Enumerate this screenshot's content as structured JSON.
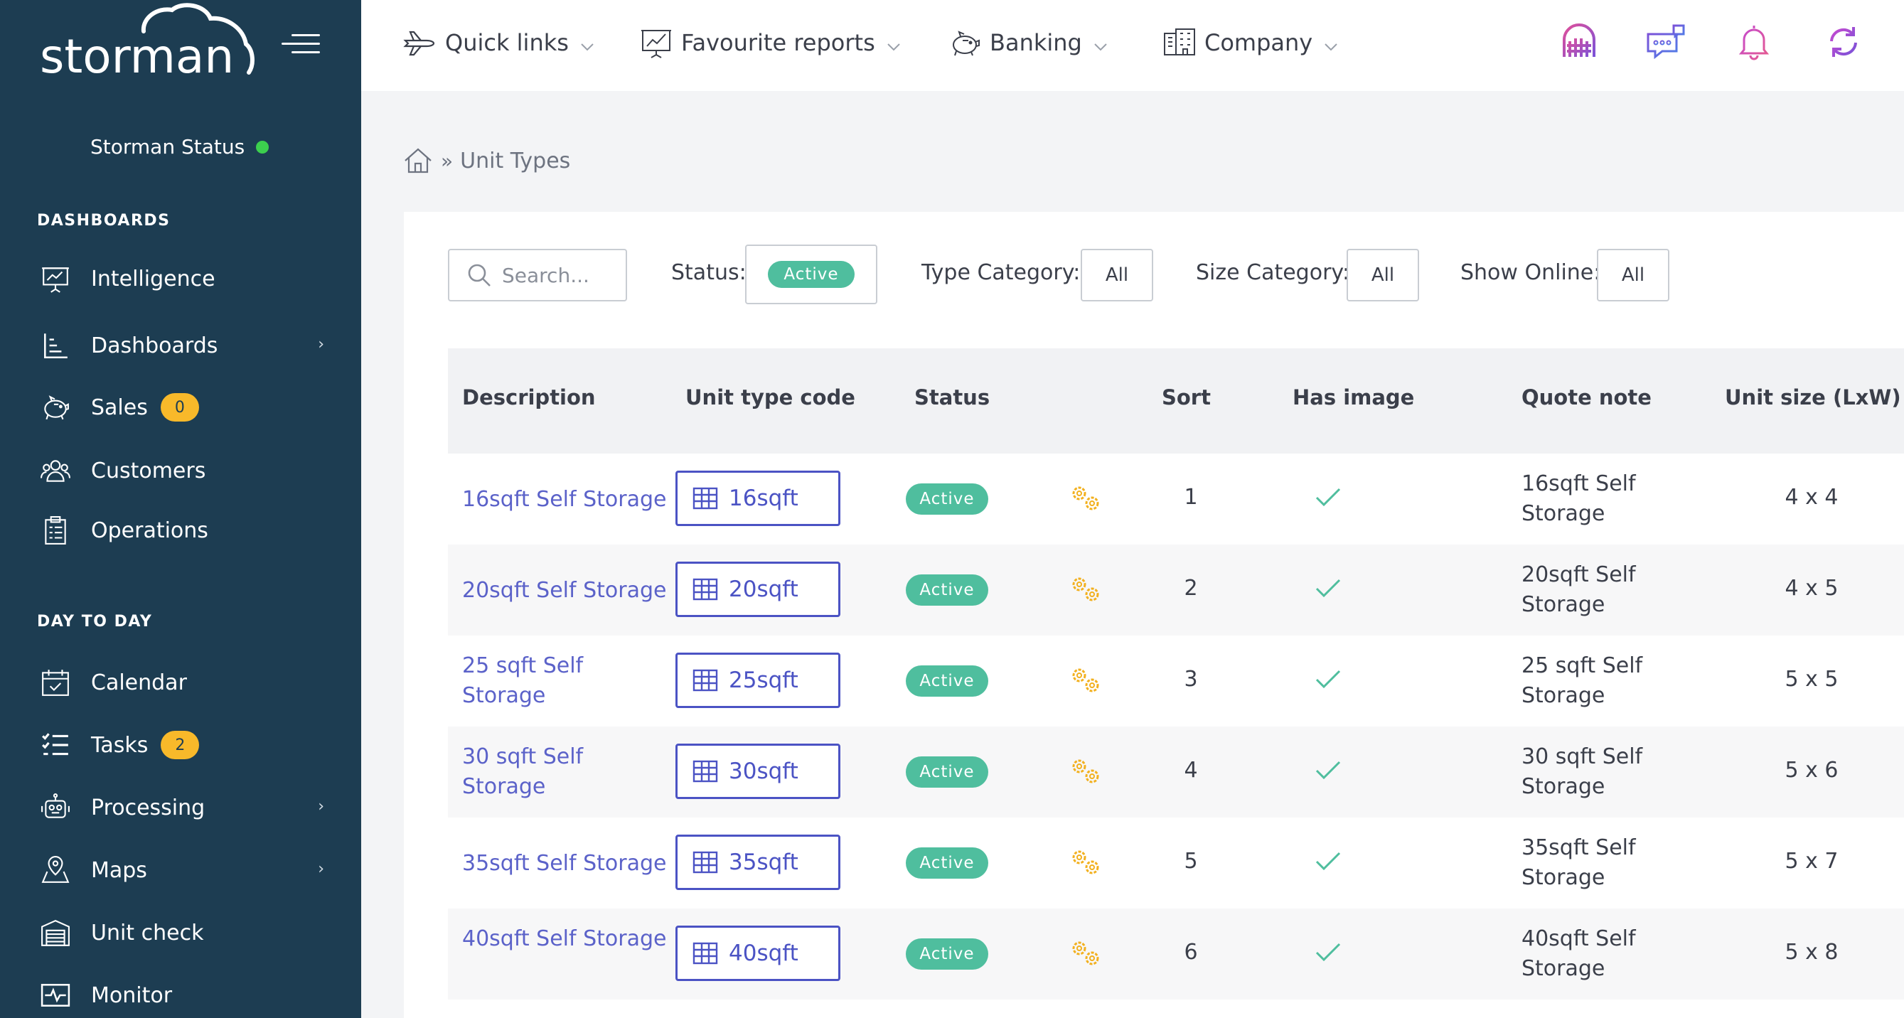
{
  "brand": {
    "logo_text": "storman"
  },
  "sidebar": {
    "status_label": "Storman Status",
    "section_dashboards": "DASHBOARDS",
    "section_day_to_day": "DAY TO DAY",
    "items": [
      {
        "label": "Intelligence",
        "icon": "presentation-chart-icon"
      },
      {
        "label": "Dashboards",
        "icon": "bar-chart-icon",
        "has_submenu": true
      },
      {
        "label": "Sales",
        "icon": "piggy-bank-icon",
        "badge": "0"
      },
      {
        "label": "Customers",
        "icon": "users-icon"
      },
      {
        "label": "Operations",
        "icon": "clipboard-icon"
      },
      {
        "label": "Calendar",
        "icon": "calendar-icon"
      },
      {
        "label": "Tasks",
        "icon": "checklist-icon",
        "badge": "2"
      },
      {
        "label": "Processing",
        "icon": "robot-icon",
        "has_submenu": true
      },
      {
        "label": "Maps",
        "icon": "map-pin-icon",
        "has_submenu": true
      },
      {
        "label": "Unit check",
        "icon": "garage-door-icon"
      },
      {
        "label": "Monitor",
        "icon": "pulse-monitor-icon"
      }
    ]
  },
  "topbar": {
    "links": [
      {
        "label": "Quick links",
        "icon": "plane-icon"
      },
      {
        "label": "Favourite reports",
        "icon": "report-chart-icon"
      },
      {
        "label": "Banking",
        "icon": "piggy-bank-icon"
      },
      {
        "label": "Company",
        "icon": "building-icon"
      }
    ],
    "icons": [
      "garage-door-gradient-icon",
      "chat-bubble-icon",
      "bell-icon",
      "refresh-icon"
    ]
  },
  "breadcrumb": {
    "current": "Unit Types"
  },
  "filters": {
    "search_placeholder": "Search...",
    "status_label": "Status:",
    "status_value": "Active",
    "type_category_label": "Type Category:",
    "type_category_value": "All",
    "size_category_label": "Size Category:",
    "size_category_value": "All",
    "show_online_label": "Show Online:",
    "show_online_value": "All"
  },
  "table": {
    "columns": [
      "Description",
      "Unit type code",
      "Status",
      "Sort",
      "Has image",
      "Quote note",
      "Unit size (LxW)"
    ],
    "rows": [
      {
        "description": "16sqft Self Storage",
        "code": "16sqft",
        "status": "Active",
        "sort": "1",
        "has_image": true,
        "quote_note": "16sqft Self Storage",
        "size": "4 x 4"
      },
      {
        "description": "20sqft Self Storage",
        "code": "20sqft",
        "status": "Active",
        "sort": "2",
        "has_image": true,
        "quote_note": "20sqft Self Storage",
        "size": "4 x 5"
      },
      {
        "description": "25 sqft Self Storage",
        "code": "25sqft",
        "status": "Active",
        "sort": "3",
        "has_image": true,
        "quote_note": "25 sqft Self Storage",
        "size": "5 x 5"
      },
      {
        "description": "30 sqft Self Storage",
        "code": "30sqft",
        "status": "Active",
        "sort": "4",
        "has_image": true,
        "quote_note": "30 sqft Self Storage",
        "size": "5 x 6"
      },
      {
        "description": "35sqft Self Storage",
        "code": "35sqft",
        "status": "Active",
        "sort": "5",
        "has_image": true,
        "quote_note": "35sqft Self Storage",
        "size": "5 x 7"
      },
      {
        "description": "40sqft Self Storage",
        "code": "40sqft",
        "status": "Active",
        "sort": "6",
        "has_image": true,
        "quote_note": "40sqft Self Storage",
        "size": "5 x 8"
      }
    ]
  },
  "colors": {
    "sidebar_bg": "#1d3d52",
    "accent": "#4b53c4",
    "link": "#5b62c9",
    "status_green": "#4fbe9e",
    "badge_yellow": "#f8b92a",
    "gear_yellow": "#f2b01e",
    "online_dot": "#3ccf4e"
  }
}
